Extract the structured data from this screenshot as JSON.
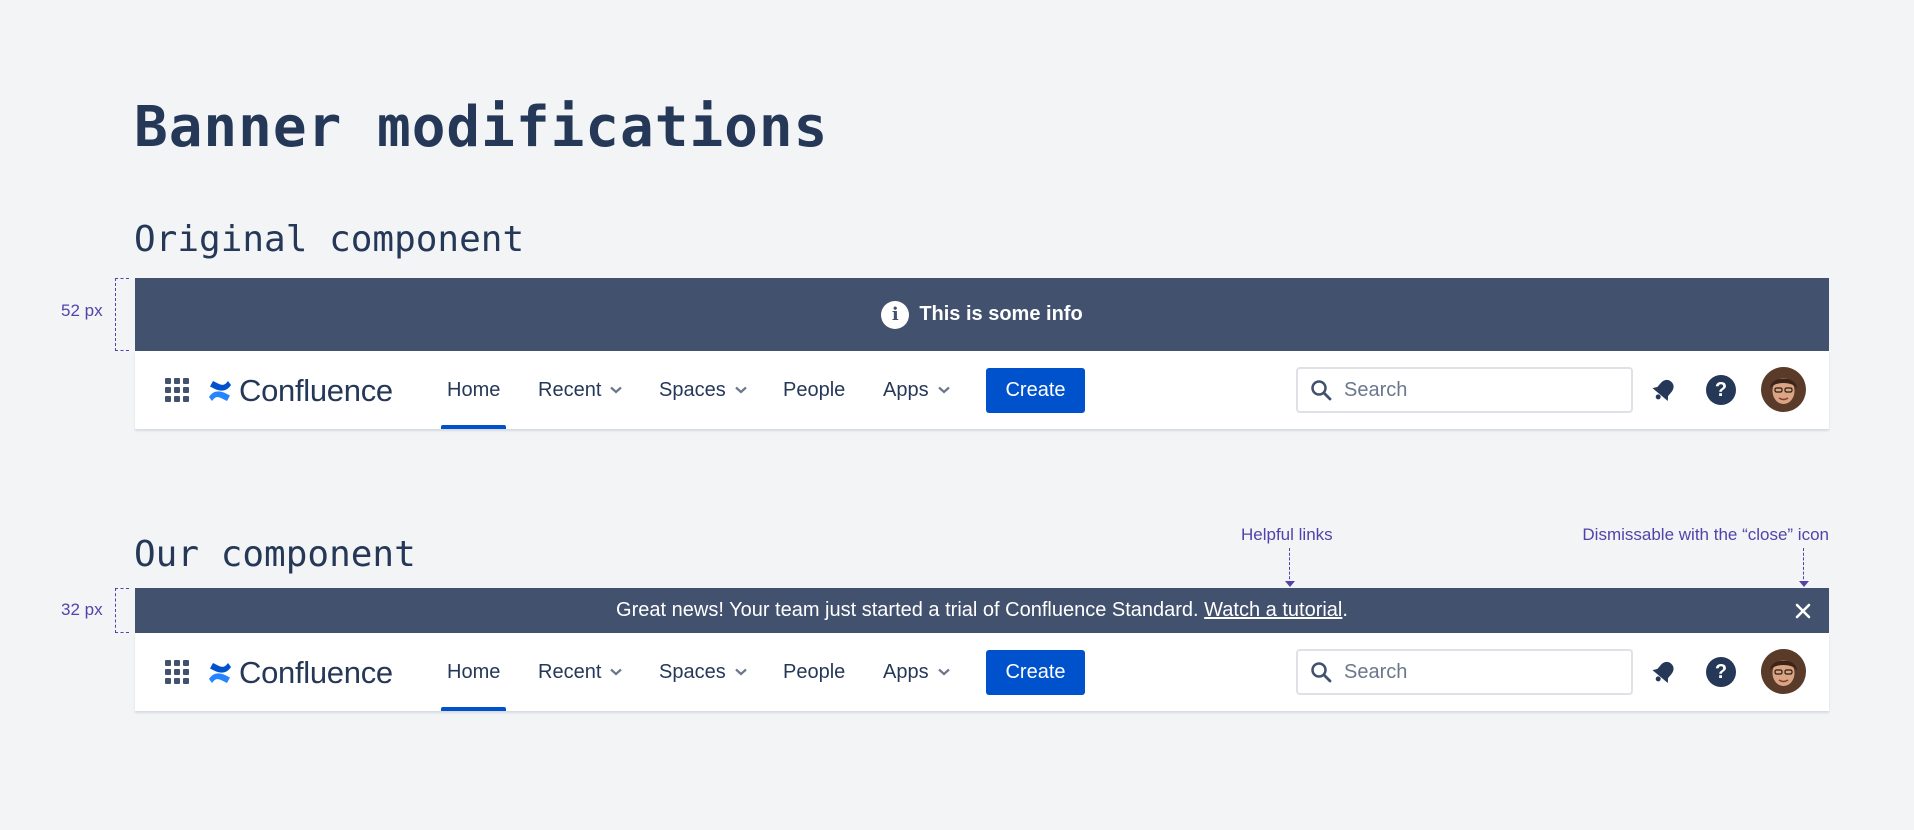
{
  "page": {
    "title": "Banner modifications",
    "section_original": "Original component",
    "section_ours": "Our component"
  },
  "annotations": {
    "original_height": "52 px",
    "ours_height": "32 px",
    "helpful_links": "Helpful links",
    "dismissable": "Dismissable with the “close” icon",
    "color": "#5243aa"
  },
  "original_banner": {
    "icon": "info-icon",
    "icon_glyph": "i",
    "text": "This is some info",
    "background": "#42526e"
  },
  "our_banner": {
    "text": "Great news! Your team just started a trial of Confluence Standard.",
    "link_text": "Watch a tutorial",
    "suffix": ".",
    "close_icon": "close-icon",
    "background": "#42526e"
  },
  "navbar": {
    "app_switcher_icon": "grid-icon",
    "logo_text": "Confluence",
    "items": [
      {
        "label": "Home",
        "active": true,
        "dropdown": false
      },
      {
        "label": "Recent",
        "active": false,
        "dropdown": true
      },
      {
        "label": "Spaces",
        "active": false,
        "dropdown": true
      },
      {
        "label": "People",
        "active": false,
        "dropdown": false
      },
      {
        "label": "Apps",
        "active": false,
        "dropdown": true
      }
    ],
    "create_label": "Create",
    "search_placeholder": "Search",
    "notifications_icon": "bell-icon",
    "help_icon": "help-icon",
    "help_glyph": "?",
    "avatar_icon": "user-avatar",
    "accent": "#0052cc",
    "brand_text_color": "#253858"
  }
}
